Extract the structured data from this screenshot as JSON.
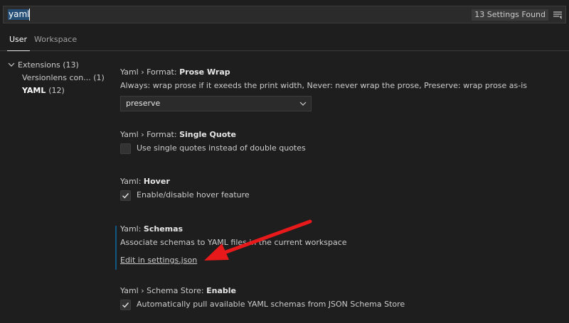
{
  "search": {
    "query": "yaml",
    "results_badge": "13 Settings Found",
    "filter_icon": "filter-list-icon"
  },
  "tabs": [
    {
      "label": "User",
      "active": true
    },
    {
      "label": "Workspace",
      "active": false
    }
  ],
  "toc": {
    "extensions": {
      "label": "Extensions",
      "count": "(13)",
      "chevron": "chevron-down-icon"
    },
    "items": [
      {
        "label": "Versionlens con...",
        "count": "(1)"
      },
      {
        "label": "YAML",
        "count": "(12)",
        "selected": true
      }
    ]
  },
  "settings": {
    "prose_wrap": {
      "prefix": "Yaml › Format: ",
      "name": "Prose Wrap",
      "description": "Always: wrap prose if it exeeds the print width, Never: never wrap the prose, Preserve: wrap prose as-is",
      "value": "preserve"
    },
    "single_quote": {
      "prefix": "Yaml › Format: ",
      "name": "Single Quote",
      "label": "Use single quotes instead of double quotes",
      "checked": false
    },
    "hover": {
      "prefix": "Yaml: ",
      "name": "Hover",
      "label": "Enable/disable hover feature",
      "checked": true
    },
    "schemas": {
      "prefix": "Yaml: ",
      "name": "Schemas",
      "description": "Associate schemas to YAML files in the current workspace",
      "link": "Edit in settings.json"
    },
    "schema_store": {
      "prefix": "Yaml › Schema Store: ",
      "name": "Enable",
      "label": "Automatically pull available YAML schemas from JSON Schema Store",
      "checked": true
    }
  },
  "colors": {
    "background": "#1e1e1e",
    "accent": "#0e639c",
    "annotation_arrow": "#e8191a"
  }
}
